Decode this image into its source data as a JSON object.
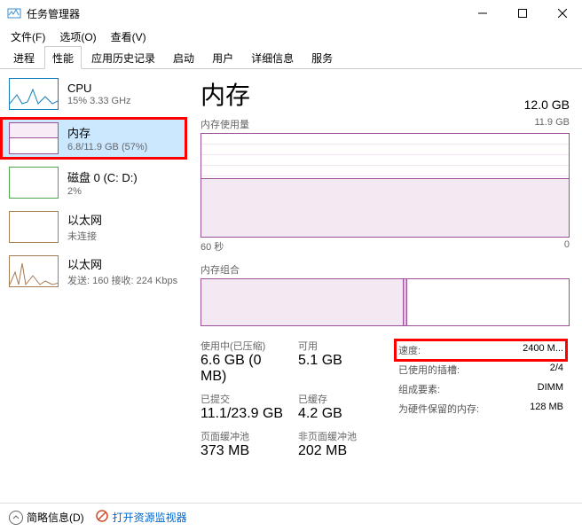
{
  "window": {
    "title": "任务管理器"
  },
  "menu": {
    "file": "文件(F)",
    "options": "选项(O)",
    "view": "查看(V)"
  },
  "tabs": [
    "进程",
    "性能",
    "应用历史记录",
    "启动",
    "用户",
    "详细信息",
    "服务"
  ],
  "sidebar": [
    {
      "title": "CPU",
      "sub": "15%  3.33 GHz",
      "kind": "cpu"
    },
    {
      "title": "内存",
      "sub": "6.8/11.9 GB (57%)",
      "kind": "mem",
      "selected": true,
      "highlight": true
    },
    {
      "title": "磁盘 0 (C: D:)",
      "sub": "2%",
      "kind": "disk"
    },
    {
      "title": "以太网",
      "sub": "未连接",
      "kind": "eth"
    },
    {
      "title": "以太网",
      "sub": "发送: 160  接收: 224 Kbps",
      "kind": "eth2"
    }
  ],
  "main": {
    "title": "内存",
    "total": "12.0 GB",
    "usage_label": "内存使用量",
    "usage_max": "11.9 GB",
    "time_left": "60 秒",
    "time_right": "0",
    "comp_label": "内存组合",
    "stats": {
      "in_use_label": "使用中(已压缩)",
      "in_use_val": "6.6 GB (0 MB)",
      "avail_label": "可用",
      "avail_val": "5.1 GB",
      "commit_label": "已提交",
      "commit_val": "11.1/23.9 GB",
      "cached_label": "已缓存",
      "cached_val": "4.2 GB",
      "paged_label": "页面缓冲池",
      "paged_val": "373 MB",
      "nonpaged_label": "非页面缓冲池",
      "nonpaged_val": "202 MB"
    },
    "right": {
      "speed_label": "速度:",
      "speed_val": "2400 M...",
      "slots_label": "已使用的插槽:",
      "slots_val": "2/4",
      "form_label": "组成要素:",
      "form_val": "DIMM",
      "hw_label": "为硬件保留的内存:",
      "hw_val": "128 MB"
    }
  },
  "footer": {
    "brief": "简略信息(D)",
    "resmon": "打开资源监视器"
  }
}
